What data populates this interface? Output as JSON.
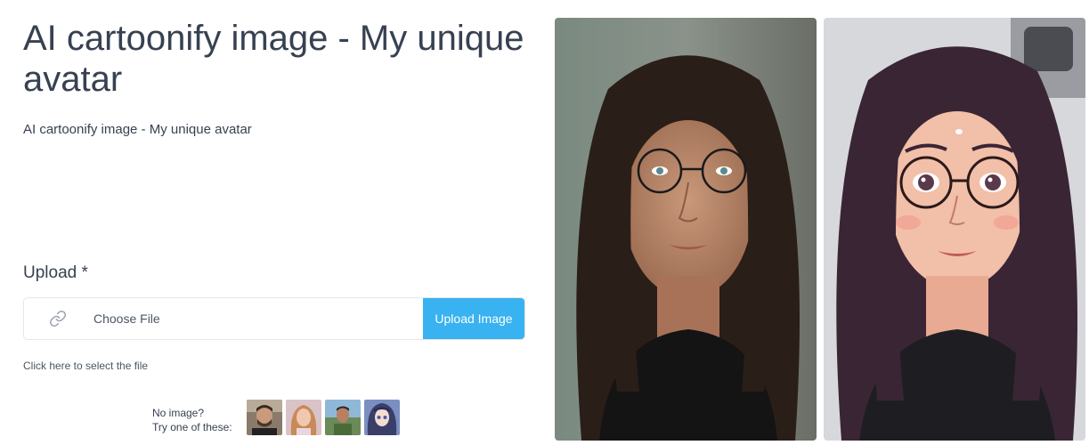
{
  "page": {
    "title": "AI cartoonify image - My unique avatar",
    "subtitle": "AI cartoonify image - My unique avatar"
  },
  "upload": {
    "label": "Upload *",
    "icon": "link-icon",
    "choose_file": "Choose File",
    "button": "Upload Image",
    "hint": "Click here to select the file",
    "button_color": "#38b2f0"
  },
  "samples": {
    "prompt_line1": "No image?",
    "prompt_line2": "Try one of these:"
  }
}
